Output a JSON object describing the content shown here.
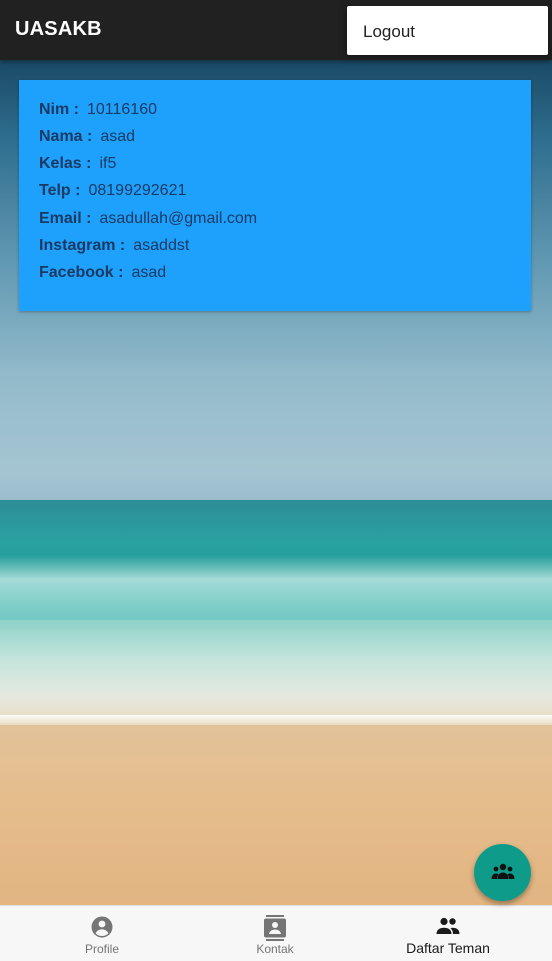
{
  "appbar": {
    "title": "UASAKB"
  },
  "menu": {
    "items": [
      {
        "label": "Logout"
      }
    ]
  },
  "profile": {
    "fields": [
      {
        "label": "Nim :",
        "value": "10116160"
      },
      {
        "label": "Nama :",
        "value": "asad"
      },
      {
        "label": "Kelas :",
        "value": "if5"
      },
      {
        "label": "Telp :",
        "value": "08199292621"
      },
      {
        "label": "Email :",
        "value": "asadullah@gmail.com"
      },
      {
        "label": "Instagram :",
        "value": "asaddst"
      },
      {
        "label": "Facebook :",
        "value": "asad"
      }
    ]
  },
  "fab": {
    "icon": "group-icon",
    "color": "#0e9b8a"
  },
  "bottom_nav": {
    "active_index": 2,
    "items": [
      {
        "label": "Profile",
        "icon": "account-circle-icon"
      },
      {
        "label": "Kontak",
        "icon": "contact-card-icon"
      },
      {
        "label": "Daftar Teman",
        "icon": "people-icon"
      }
    ]
  },
  "colors": {
    "appbar": "#212121",
    "card": "#1da1fc",
    "card_text": "#1b3a63"
  }
}
